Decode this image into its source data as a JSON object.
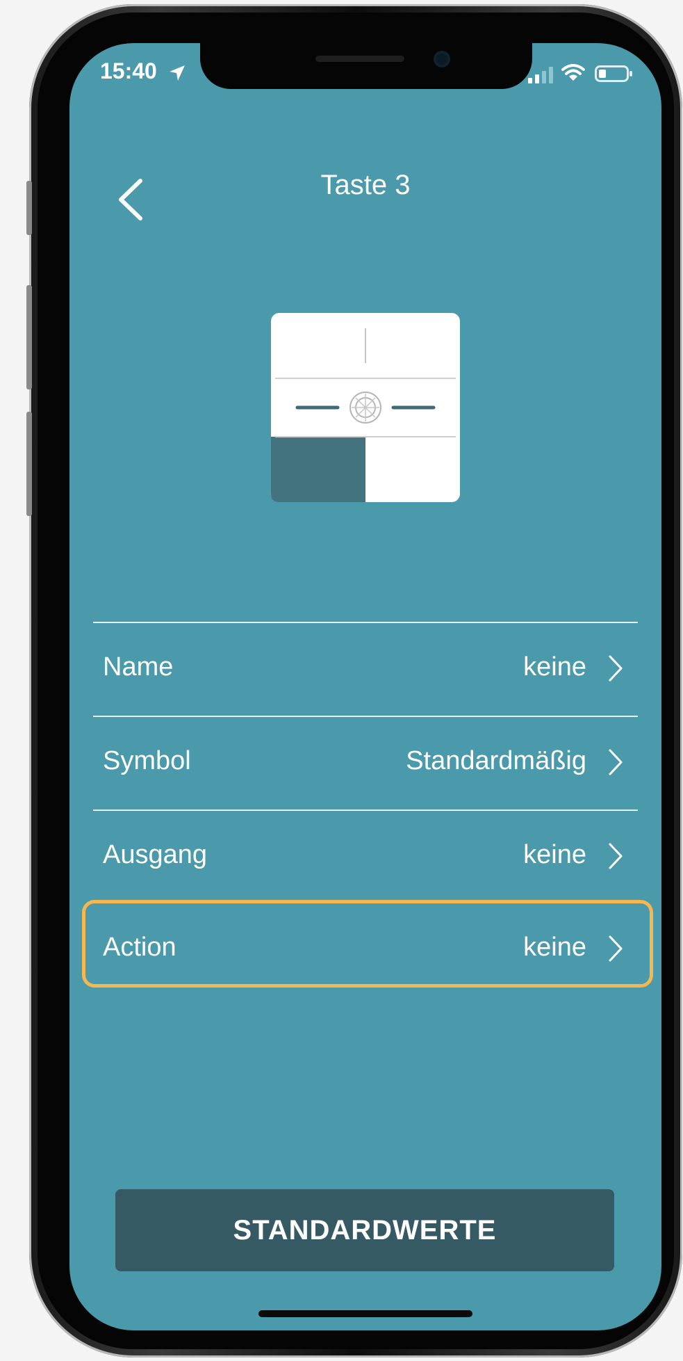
{
  "status_bar": {
    "time": "15:40"
  },
  "header": {
    "title": "Taste 3"
  },
  "settings": [
    {
      "label": "Name",
      "value": "keine"
    },
    {
      "label": "Symbol",
      "value": "Standardmäßig"
    },
    {
      "label": "Ausgang",
      "value": "keine"
    },
    {
      "label": "Action",
      "value": "keine"
    }
  ],
  "footer": {
    "button_label": "STANDARDWERTE"
  },
  "colors": {
    "screen_background": "#4a9aab",
    "button_background": "#365a63",
    "highlight": "#f5b74e",
    "selected_key": "#43737f"
  },
  "icons": [
    "back-chevron-icon",
    "location-arrow-icon",
    "cellular-signal-icon",
    "wifi-icon",
    "battery-icon",
    "chevron-right-icon"
  ]
}
